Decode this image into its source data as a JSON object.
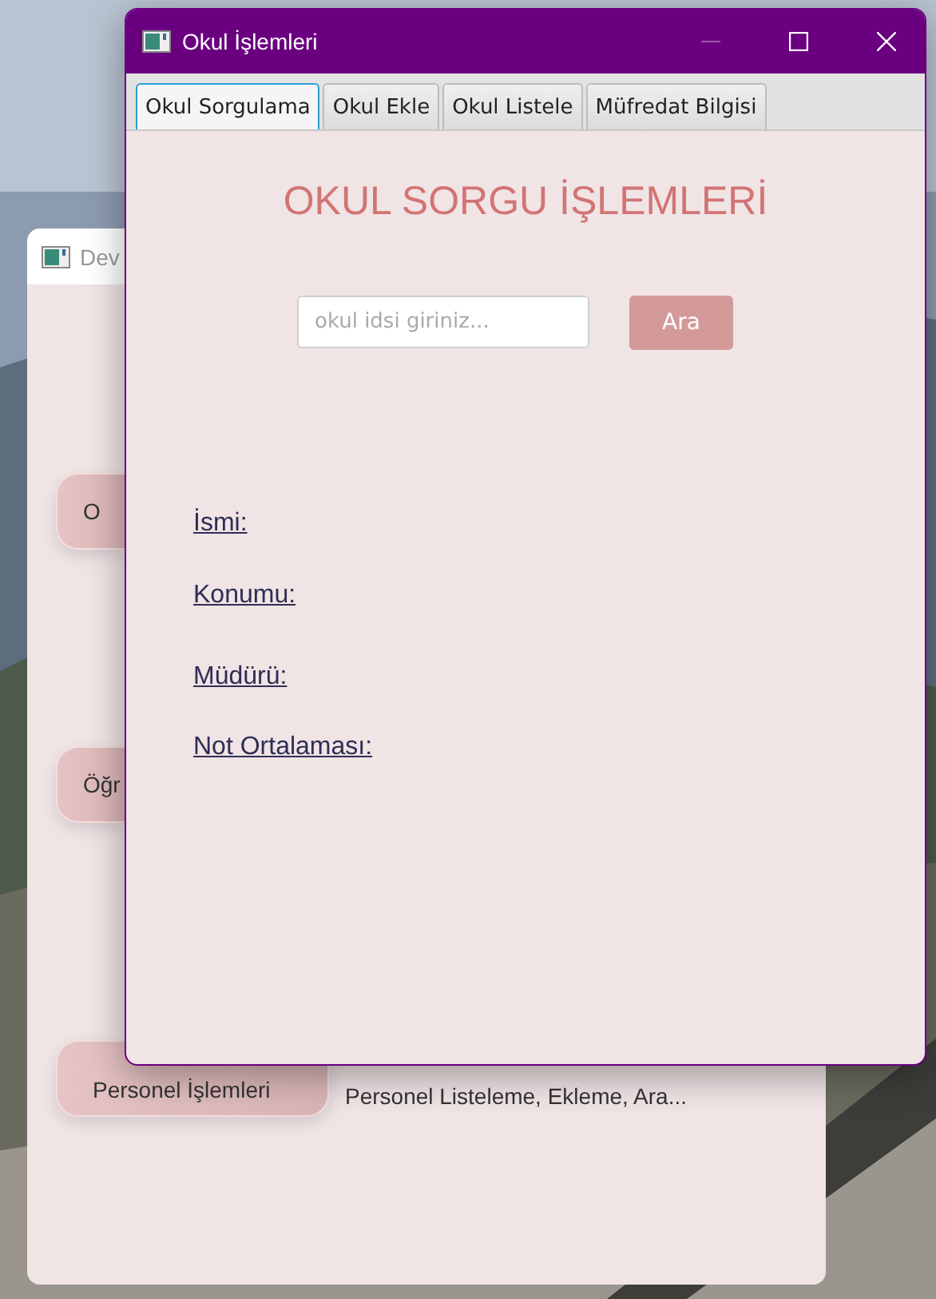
{
  "back_window": {
    "title": "Dev",
    "buttons": [
      {
        "label": "O"
      },
      {
        "label": "Öğr"
      },
      {
        "label": "Personel İşlemleri",
        "description": "Personel Listeleme, Ekleme, Ara..."
      }
    ]
  },
  "window": {
    "title": "Okul İşlemleri",
    "tabs": [
      {
        "label": "Okul Sorgulama",
        "selected": true
      },
      {
        "label": "Okul Ekle",
        "selected": false
      },
      {
        "label": "Okul Listele",
        "selected": false
      },
      {
        "label": "Müfredat Bilgisi",
        "selected": false
      }
    ],
    "heading": "OKUL SORGU İŞLEMLERİ",
    "search": {
      "placeholder": "okul idsi giriniz..."
    },
    "search_button": "Ara",
    "fields": [
      "İsmi:",
      "Konumu:",
      "Müdürü:",
      "Not Ortalaması:"
    ]
  }
}
